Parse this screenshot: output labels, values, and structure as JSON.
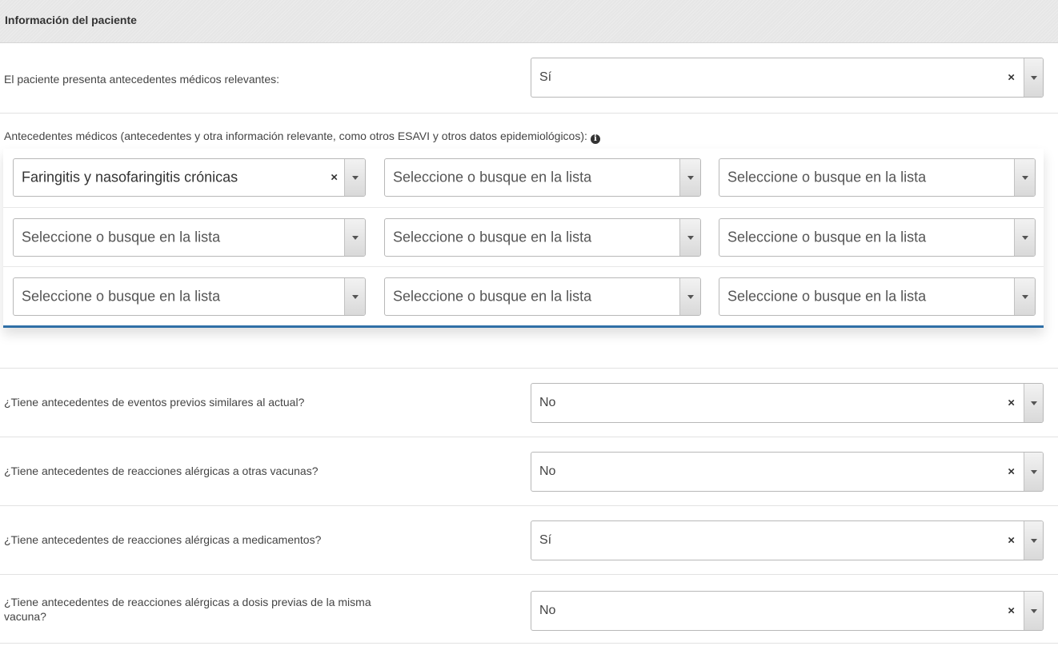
{
  "section": {
    "title": "Información del paciente"
  },
  "medical_history": {
    "label": "El paciente presenta antecedentes médicos relevantes:",
    "value": "Sí"
  },
  "antecedents": {
    "label": "Antecedentes médicos (antecedentes y otra información relevante, como otros ESAVI y otros datos epidemiológicos):",
    "info_icon": "info-circle-icon",
    "placeholder": "Seleccione o busque en la lista",
    "selected": "Faringitis y nasofaringitis crónicas"
  },
  "questions": [
    {
      "label": "¿Tiene antecedentes de eventos previos similares al actual?",
      "value": "No"
    },
    {
      "label": "¿Tiene antecedentes de reacciones alérgicas a otras vacunas?",
      "value": "No"
    },
    {
      "label": "¿Tiene antecedentes de reacciones alérgicas a medicamentos?",
      "value": "Sí"
    },
    {
      "label_line1": "¿Tiene antecedentes de reacciones alérgicas a dosis previas de la misma",
      "label_line2": "vacuna?",
      "value": "No"
    }
  ],
  "icons": {
    "clear": "×",
    "dropdown": "chevron-down-icon"
  },
  "colors": {
    "accent": "#2f6fa6",
    "header_bg": "#e6e6e6"
  }
}
